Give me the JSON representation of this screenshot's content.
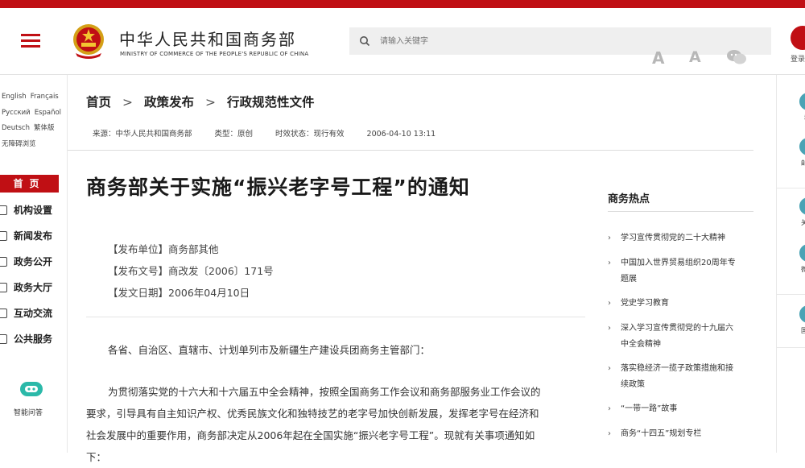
{
  "header": {
    "brand_cn": "中华人民共和国商务部",
    "brand_en": "MINISTRY OF COMMERCE OF THE PEOPLE'S REPUBLIC OF CHINA",
    "search_placeholder": "请输入关键字",
    "login_label": "登录",
    "accent_color": "#c00f14"
  },
  "languages": [
    "English",
    "Français",
    "Русский",
    "Español",
    "Deutsch",
    "繁体版",
    "无障碍浏览"
  ],
  "nav": {
    "home": "首页",
    "items": [
      {
        "label": "机构设置",
        "icon": "org-chart-icon"
      },
      {
        "label": "新闻发布",
        "icon": "mic-icon"
      },
      {
        "label": "政务公开",
        "icon": "document-icon"
      },
      {
        "label": "政务大厅",
        "icon": "building-icon"
      },
      {
        "label": "互动交流",
        "icon": "chat-icon"
      },
      {
        "label": "公共服务",
        "icon": "service-icon"
      }
    ],
    "ai_label": "智能问答"
  },
  "breadcrumb": [
    "首页",
    "政策发布",
    "行政规范性文件"
  ],
  "meta": {
    "source": "来源：中华人民共和国商务部",
    "type": "类型：原创",
    "status": "时效状态：现行有效",
    "date": "2006-04-10 13:11"
  },
  "tools": {
    "font_large": "A",
    "font_small": "A"
  },
  "article": {
    "title": "商务部关于实施“振兴老字号工程”的通知",
    "issuer": "【发布单位】商务部其他",
    "doc_no": "【发布文号】商改发〔2006〕171号",
    "pub_date": "【发文日期】2006年04月10日",
    "salutation": "各省、自治区、直辖市、计划单列市及新疆生产建设兵团商务主管部门：",
    "body_line1": "为贯彻落实党的十六大和十六届五中全会精神，按照全国商务工作会议和商务部服务业工作会议的",
    "body_line2": "要求，引导具有自主知识产权、优秀民族文化和独特技艺的老字号加快创新发展，发挥老字号在经济和",
    "body_line3": "社会发展中的重要作用，商务部决定从2006年起在全国实施“振兴老字号工程”。现就有关事项通知如",
    "body_line4": "下："
  },
  "hot": {
    "title": "商务热点",
    "items": [
      [
        "学习宣传贯彻党的二十大精神"
      ],
      [
        "中国加入世界贸易组织20周年专",
        "题展"
      ],
      [
        "党史学习教育"
      ],
      [
        "深入学习宣传贯彻党的十九届六",
        "中全会精神"
      ],
      [
        "落实稳经济一揽子政策措施和接",
        "续政策"
      ],
      [
        "“一带一路”故事"
      ],
      [
        "商务“十四五”规划专栏"
      ]
    ]
  },
  "right_rail": [
    {
      "label": "移",
      "icon": "mobile-icon"
    },
    {
      "label": "邮箱",
      "icon": "mail-icon"
    },
    {
      "label": "关注",
      "icon": "weibo-icon"
    },
    {
      "label": "微信",
      "icon": "wechat-icon"
    },
    {
      "label": "国务",
      "icon": "state-council-icon"
    }
  ]
}
